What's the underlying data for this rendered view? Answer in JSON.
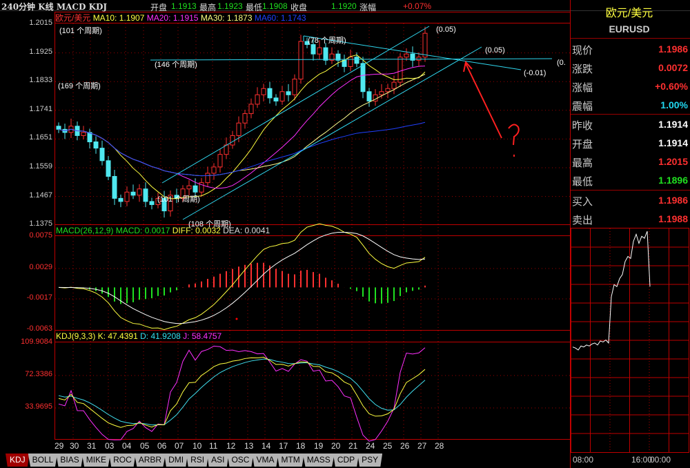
{
  "header": {
    "title": "240分钟 K线 MACD KDJ",
    "quotes": [
      {
        "label": "开盘",
        "value": "1.1913"
      },
      {
        "label": "最高",
        "value": "1.1923"
      },
      {
        "label": "最低",
        "value": "1.1908"
      },
      {
        "label": "收盘",
        "value": "1.1920"
      },
      {
        "label": "涨幅",
        "value": "+0.07%"
      }
    ]
  },
  "main": {
    "symbol": "欧元/美元",
    "ma10": "MA10: 1.1907",
    "ma20": "MA20: 1.1915",
    "ma30": "MA30: 1.1873",
    "ma60": "MA60: 1.1743",
    "y_labels": [
      "1.2015",
      "1.1925",
      "1.1833",
      "1.1741",
      "1.1651",
      "1.1559",
      "1.1467",
      "1.1375"
    ],
    "annotations": [
      "(101 个周期)",
      "(146 个周期)",
      "(169 个周期)",
      "(78 个周期)",
      "(101 个周期)",
      "(108 个周期)",
      "(0.05)",
      "(0.05)",
      "(-0.01)",
      "(0.",
      "?"
    ]
  },
  "macd": {
    "title": "MACD(26,12,9)",
    "macd": "MACD: 0.0017",
    "diff": "DIFF: 0.0032",
    "dea": "DEA: 0.0041",
    "y_labels": [
      "0.0075",
      "0.0029",
      "-0.0017",
      "-0.0063"
    ]
  },
  "kdj": {
    "title": "KDJ(9,3,3)",
    "k": "K: 47.4391",
    "d": "D: 41.9208",
    "j": "J: 58.4757",
    "y_labels": [
      "109.9084",
      "72.3386",
      "33.9695"
    ]
  },
  "dates": [
    "29",
    "30",
    "31",
    "03",
    "04",
    "05",
    "06",
    "07",
    "10",
    "11",
    "12",
    "13",
    "14",
    "17",
    "18",
    "19",
    "20",
    "21",
    "24",
    "25",
    "26",
    "27",
    "28"
  ],
  "tabs": [
    "KDJ",
    "BOLL",
    "BIAS",
    "MIKE",
    "ROC",
    "ARBR",
    "DMI",
    "RSI",
    "ASI",
    "OSC",
    "VMA",
    "MTM",
    "MASS",
    "CDP",
    "PSY"
  ],
  "right_panel": {
    "name": "欧元/美元",
    "code": "EURUSD",
    "rows": [
      {
        "label": "现价",
        "value": "1.1986",
        "color": "#ff3030"
      },
      {
        "label": "涨跌",
        "value": "0.0072",
        "color": "#ff3030"
      },
      {
        "label": "涨幅",
        "value": "+0.60%",
        "color": "#ff3030"
      },
      {
        "label": "震幅",
        "value": "1.00%",
        "color": "#20d8f0"
      },
      {
        "label": "昨收",
        "value": "1.1914",
        "color": "#ffffff"
      },
      {
        "label": "开盘",
        "value": "1.1914",
        "color": "#ffffff"
      },
      {
        "label": "最高",
        "value": "1.2015",
        "color": "#ff3030"
      },
      {
        "label": "最低",
        "value": "1.1896",
        "color": "#20e020"
      },
      {
        "label": "买入",
        "value": "1.1986",
        "color": "#ff3030"
      },
      {
        "label": "卖出",
        "value": "1.1988",
        "color": "#ff3030"
      }
    ],
    "time_labels": [
      "08:00",
      "16:00",
      "00:00"
    ]
  },
  "chart_data": {
    "type": "candlestick",
    "title": "欧元/美元 240分钟",
    "ylim": [
      1.1375,
      1.2015
    ],
    "close": [
      1.168,
      1.167,
      1.169,
      1.166,
      1.167,
      1.164,
      1.162,
      1.158,
      1.153,
      1.146,
      1.145,
      1.148,
      1.147,
      1.149,
      1.145,
      1.144,
      1.146,
      1.142,
      1.147,
      1.146,
      1.149,
      1.15,
      1.148,
      1.151,
      1.154,
      1.156,
      1.16,
      1.163,
      1.166,
      1.17,
      1.173,
      1.176,
      1.179,
      1.181,
      1.178,
      1.177,
      1.18,
      1.179,
      1.184,
      1.196,
      1.195,
      1.192,
      1.194,
      1.19,
      1.192,
      1.19,
      1.188,
      1.191,
      1.189,
      1.18,
      1.177,
      1.179,
      1.18,
      1.181,
      1.183,
      1.191,
      1.192,
      1.19,
      1.191,
      1.1986
    ],
    "ma_periods": [
      10,
      20,
      30,
      60
    ],
    "intraday": [
      1.19,
      1.1899,
      1.1897,
      1.1901,
      1.19,
      1.1902,
      1.1901,
      1.1903,
      1.1904,
      1.1902,
      1.1906,
      1.1905,
      1.1907,
      1.1904,
      1.195,
      1.1962,
      1.196,
      1.1968,
      1.1972,
      1.1985,
      1.199,
      1.1988,
      1.2005,
      1.2012,
      1.2003,
      1.201,
      1.2008,
      1.2015,
      1.196
    ]
  }
}
